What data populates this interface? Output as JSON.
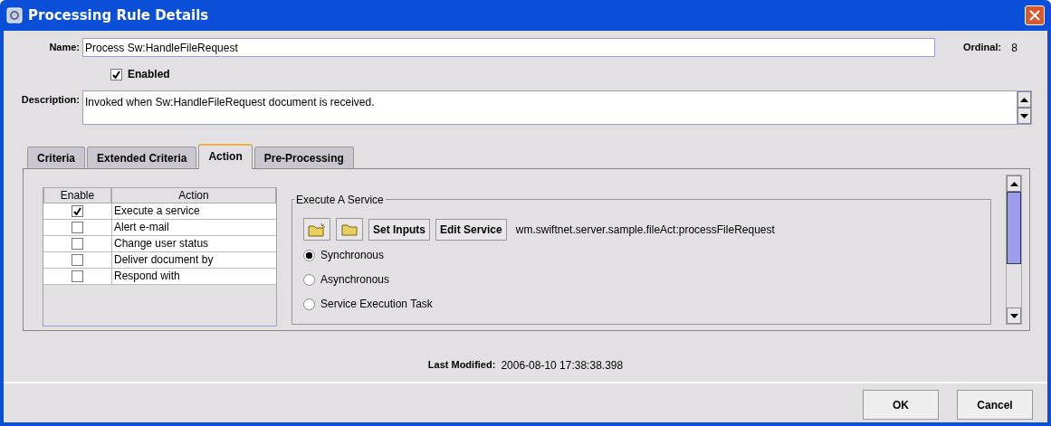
{
  "window": {
    "title": "Processing Rule Details"
  },
  "name": {
    "label": "Name:",
    "value": "Process Sw:HandleFileRequest"
  },
  "ordinal": {
    "label": "Ordinal:",
    "value": "8"
  },
  "enabled": {
    "label": "Enabled",
    "checked": true
  },
  "description": {
    "label": "Description:",
    "value": "Invoked when Sw:HandleFileRequest document is received."
  },
  "tabs": [
    {
      "label": "Criteria",
      "selected": false
    },
    {
      "label": "Extended Criteria",
      "selected": false
    },
    {
      "label": "Action",
      "selected": true
    },
    {
      "label": "Pre-Processing",
      "selected": false
    }
  ],
  "actions_table": {
    "columns": [
      "Enable",
      "Action"
    ],
    "rows": [
      {
        "action": "Execute a service",
        "enabled": true
      },
      {
        "action": "Alert e-mail",
        "enabled": false
      },
      {
        "action": "Change user status",
        "enabled": false
      },
      {
        "action": "Deliver document by",
        "enabled": false
      },
      {
        "action": "Respond with",
        "enabled": false
      }
    ]
  },
  "service_group": {
    "title": "Execute A Service",
    "buttons": [
      "Set Inputs",
      "Edit Service"
    ],
    "service": "wm.swiftnet.server.sample.fileAct:processFileRequest",
    "modes": [
      {
        "label": "Synchronous",
        "selected": true
      },
      {
        "label": "Asynchronous",
        "selected": false
      },
      {
        "label": "Service Execution Task",
        "selected": false
      }
    ]
  },
  "last_modified": {
    "label": "Last Modified:",
    "value": "2006-08-10 17:38:38.398"
  },
  "buttons": [
    "OK",
    "Cancel"
  ]
}
